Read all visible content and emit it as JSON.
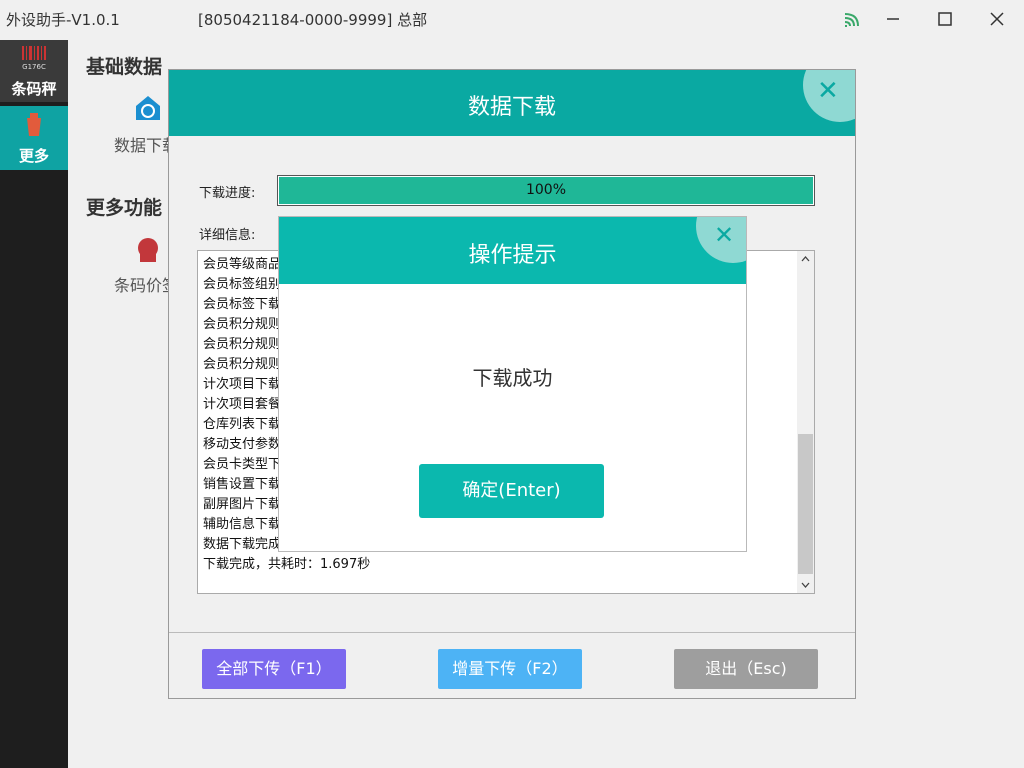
{
  "window": {
    "app_title": "外设助手-V1.0.1",
    "device_info": "[8050421184-0000-9999] 总部"
  },
  "sidebar": {
    "logo_label": "条码秤",
    "more_label": "更多"
  },
  "content": {
    "basic_data_title": "基础数据",
    "basic_tile_label": "数据下载",
    "more_features_title": "更多功能",
    "more_tile_label": "条码价签"
  },
  "download_dialog": {
    "title": "数据下载",
    "progress_label": "下载进度:",
    "progress_value": 100,
    "progress_text": "100%",
    "detail_label": "详细信息:",
    "log_lines": [
      "会员等级商品",
      "会员标签组别",
      "会员标签下载",
      "会员积分规则",
      "会员积分规则",
      "会员积分规则",
      "计次项目下载",
      "计次项目套餐",
      "仓库列表下载",
      "移动支付参数",
      "会员卡类型下",
      "销售设置下载",
      "副屏图片下载",
      "辅助信息下载",
      "数据下载完成",
      "下载完成，共耗时：1.697秒"
    ],
    "buttons": {
      "all_upload": "全部下传（F1）",
      "incremental_upload": "增量下传（F2）",
      "exit": "退出（Esc)"
    },
    "colors": {
      "header": "#0aa9a2",
      "all_upload": "#7b68ee",
      "incremental_upload": "#4db3f5",
      "exit": "#9e9e9e"
    }
  },
  "alert_dialog": {
    "title": "操作提示",
    "message": "下载成功",
    "confirm_label": "确定(Enter)"
  }
}
